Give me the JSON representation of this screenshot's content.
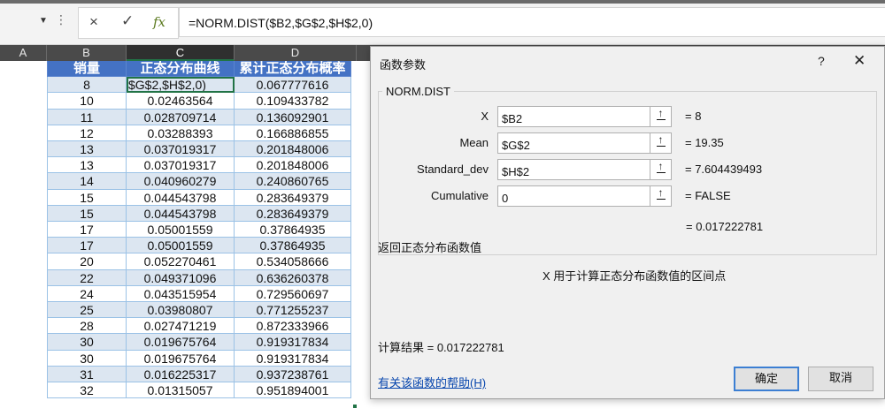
{
  "formula_bar": {
    "formula": "=NORM.DIST($B2,$G$2,$H$2,0)",
    "cancel_icon": "×",
    "enter_icon": "✓",
    "fx_icon": "fx"
  },
  "columns": [
    {
      "label": "A",
      "selected": false
    },
    {
      "label": "B",
      "selected": false
    },
    {
      "label": "C",
      "selected": true
    },
    {
      "label": "D",
      "selected": false
    }
  ],
  "table": {
    "headers": [
      "销量",
      "正态分布曲线",
      "累计正态分布概率"
    ],
    "active_cell_text": "$G$2,$H$2,0)",
    "rows": [
      [
        "8",
        "",
        "0.067777616"
      ],
      [
        "10",
        "0.02463564",
        "0.109433782"
      ],
      [
        "11",
        "0.028709714",
        "0.136092901"
      ],
      [
        "12",
        "0.03288393",
        "0.166886855"
      ],
      [
        "13",
        "0.037019317",
        "0.201848006"
      ],
      [
        "13",
        "0.037019317",
        "0.201848006"
      ],
      [
        "14",
        "0.040960279",
        "0.240860765"
      ],
      [
        "15",
        "0.044543798",
        "0.283649379"
      ],
      [
        "15",
        "0.044543798",
        "0.283649379"
      ],
      [
        "17",
        "0.05001559",
        "0.37864935"
      ],
      [
        "17",
        "0.05001559",
        "0.37864935"
      ],
      [
        "20",
        "0.052270461",
        "0.534058666"
      ],
      [
        "22",
        "0.049371096",
        "0.636260378"
      ],
      [
        "24",
        "0.043515954",
        "0.729560697"
      ],
      [
        "25",
        "0.03980807",
        "0.771255237"
      ],
      [
        "28",
        "0.027471219",
        "0.872333966"
      ],
      [
        "30",
        "0.019675764",
        "0.919317834"
      ],
      [
        "30",
        "0.019675764",
        "0.919317834"
      ],
      [
        "31",
        "0.016225317",
        "0.937238761"
      ],
      [
        "32",
        "0.01315057",
        "0.951894001"
      ]
    ]
  },
  "dialog": {
    "title": "函数参数",
    "help_button": "?",
    "close_button": "✕",
    "function_name": "NORM.DIST",
    "args": [
      {
        "label": "X",
        "value": "$B2",
        "result": "=  8"
      },
      {
        "label": "Mean",
        "value": "$G$2",
        "result": "=  19.35"
      },
      {
        "label": "Standard_dev",
        "value": "$H$2",
        "result": "=  7.604439493"
      },
      {
        "label": "Cumulative",
        "value": "0",
        "result": "=  FALSE"
      }
    ],
    "formula_result": "=  0.017222781",
    "description": "返回正态分布函数值",
    "arg_description": "X  用于计算正态分布函数值的区间点",
    "calc_result": "计算结果 =  0.017222781",
    "help_link": "有关该函数的帮助(H)",
    "ok_button": "确定",
    "cancel_button": "取消"
  }
}
